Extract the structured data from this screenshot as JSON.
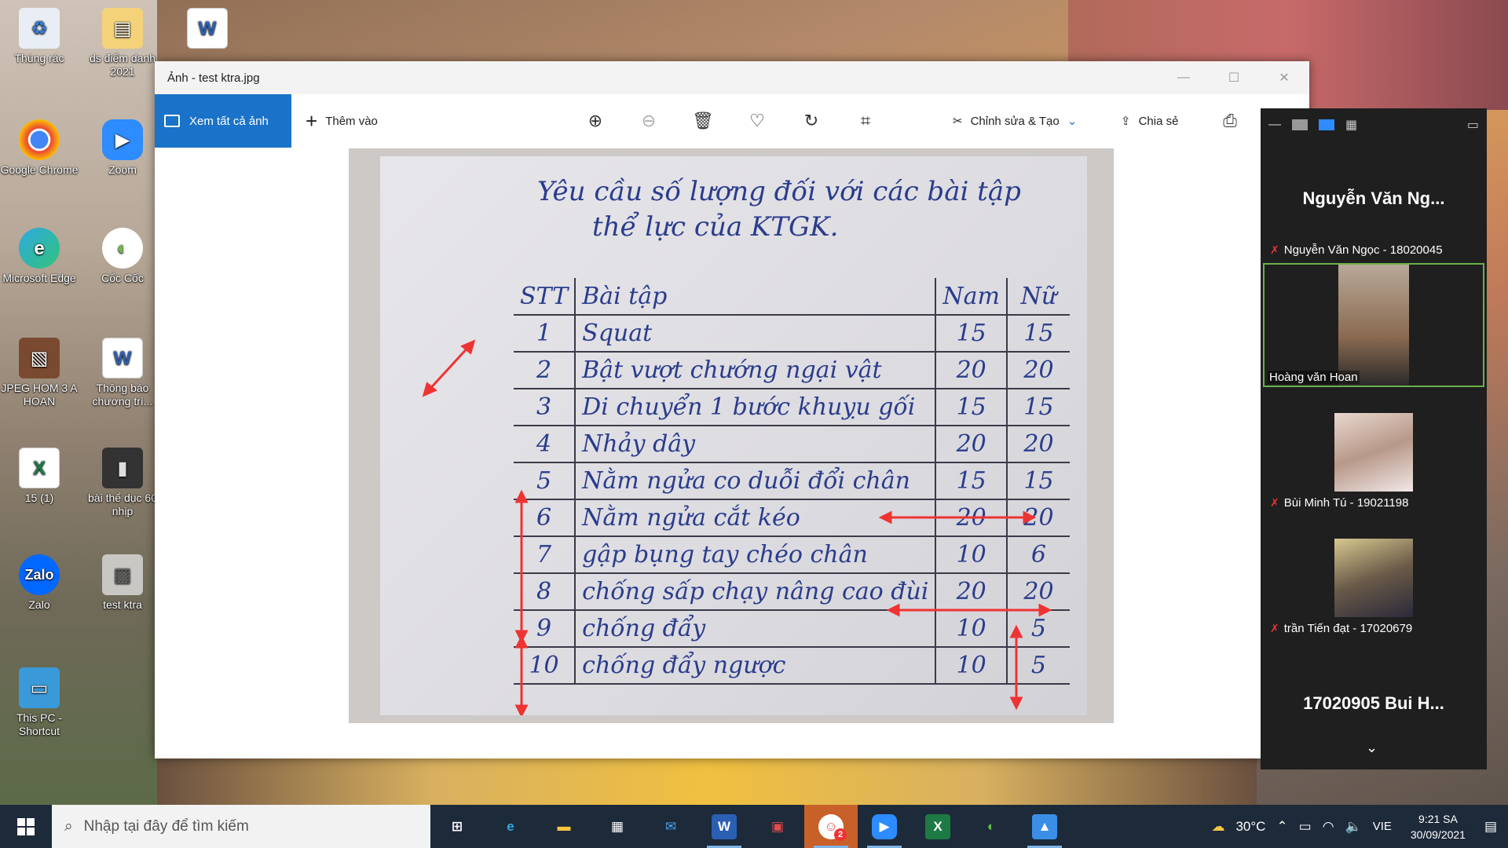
{
  "desktop": {
    "icons": [
      {
        "label": "Thùng rác",
        "icon": "recycle-bin-icon"
      },
      {
        "label": "ds điểm danh 2021",
        "icon": "folder-icon"
      },
      {
        "label": "",
        "icon": "word-document-icon"
      },
      {
        "label": "Google Chrome",
        "icon": "chrome-icon"
      },
      {
        "label": "Zoom",
        "icon": "zoom-icon"
      },
      {
        "label": "Microsoft Edge",
        "icon": "edge-icon"
      },
      {
        "label": "Cốc Cốc",
        "icon": "coccoc-icon"
      },
      {
        "label": "JPEG HOM 3 A HOAN",
        "icon": "jpeg-file-icon"
      },
      {
        "label": "Thông báo chương trì...",
        "icon": "word-document-icon"
      },
      {
        "label": "15 (1)",
        "icon": "excel-file-icon"
      },
      {
        "label": "bài thể dục 60 nhịp",
        "icon": "video-file-icon"
      },
      {
        "label": "Zalo",
        "icon": "zalo-icon"
      },
      {
        "label": "test ktra",
        "icon": "image-file-icon"
      },
      {
        "label": "This PC - Shortcut",
        "icon": "this-pc-icon"
      }
    ]
  },
  "photos": {
    "window_title": "Ảnh - test ktra.jpg",
    "toolbar": {
      "view_all": "Xem tất cả ảnh",
      "add": "Thêm vào",
      "edit_create": "Chỉnh sửa & Tạo",
      "share": "Chia sẻ"
    },
    "image": {
      "heading_line1": "Yêu cầu số lượng đối với các bài tập",
      "heading_line2": "thể lực của KTGK.",
      "table_header": {
        "stt": "STT",
        "exercise": "Bài tập",
        "male": "Nam",
        "female": "Nữ"
      },
      "rows": [
        {
          "stt": "1",
          "exercise": "Squat",
          "male": "15",
          "female": "15"
        },
        {
          "stt": "2",
          "exercise": "Bật vượt chướng ngại vật",
          "male": "20",
          "female": "20"
        },
        {
          "stt": "3",
          "exercise": "Di chuyển 1 bước khuỵu gối",
          "male": "15",
          "female": "15"
        },
        {
          "stt": "4",
          "exercise": "Nhảy dây",
          "male": "20",
          "female": "20"
        },
        {
          "stt": "5",
          "exercise": "Nằm ngửa co duỗi đổi chân",
          "male": "15",
          "female": "15"
        },
        {
          "stt": "6",
          "exercise": "Nằm ngửa cắt kéo",
          "male": "20",
          "female": "20"
        },
        {
          "stt": "7",
          "exercise": "gập bụng tay chéo chân",
          "male": "10",
          "female": "6"
        },
        {
          "stt": "8",
          "exercise": "chống sấp chạy nâng cao đùi",
          "male": "20",
          "female": "20"
        },
        {
          "stt": "9",
          "exercise": "chống đẩy",
          "male": "10",
          "female": "5"
        },
        {
          "stt": "10",
          "exercise": "chống đẩy ngược",
          "male": "10",
          "female": "5"
        }
      ]
    }
  },
  "zoom": {
    "participants": [
      {
        "big_name": "Nguyễn Văn Ng...",
        "label": "Nguyễn Văn Ngọc - 18020045",
        "muted": true
      },
      {
        "video_name": "Hoàng văn Hoan",
        "has_video": true
      },
      {
        "label": "Bùi Minh Tú - 19021198",
        "muted": true
      },
      {
        "label": "trần Tiến đạt - 17020679",
        "muted": true
      },
      {
        "big_name": "17020905 Bui H..."
      }
    ],
    "mic_off_glyph": "✗"
  },
  "taskbar": {
    "search_placeholder": "Nhập tại đây để tìm kiếm",
    "apps": [
      {
        "name": "task-view",
        "glyph": "⊞",
        "color": "#ffffff"
      },
      {
        "name": "edge",
        "glyph": "e",
        "color": "#2fa8e0"
      },
      {
        "name": "file-explorer",
        "glyph": "▬",
        "color": "#f4c542"
      },
      {
        "name": "store",
        "glyph": "▦",
        "color": "#cccccc"
      },
      {
        "name": "mail",
        "glyph": "✉",
        "color": "#4aa0e6"
      },
      {
        "name": "word",
        "glyph": "W",
        "color": "#2b5fb3"
      },
      {
        "name": "app-red",
        "glyph": "▣",
        "color": "#e64a4a"
      },
      {
        "name": "chat-app",
        "glyph": "☺",
        "color": "#e64a4a",
        "badge": "2"
      },
      {
        "name": "zoom",
        "glyph": "▶",
        "color": "#2d8cff"
      },
      {
        "name": "excel",
        "glyph": "X",
        "color": "#1e7a44"
      },
      {
        "name": "coccoc",
        "glyph": "◐",
        "color": "#6abd45"
      },
      {
        "name": "photos",
        "glyph": "▲",
        "color": "#3a8ee6"
      }
    ],
    "tray": {
      "temperature": "30°C",
      "language": "VIE",
      "time": "9:21 SA",
      "date": "30/09/2021"
    }
  }
}
